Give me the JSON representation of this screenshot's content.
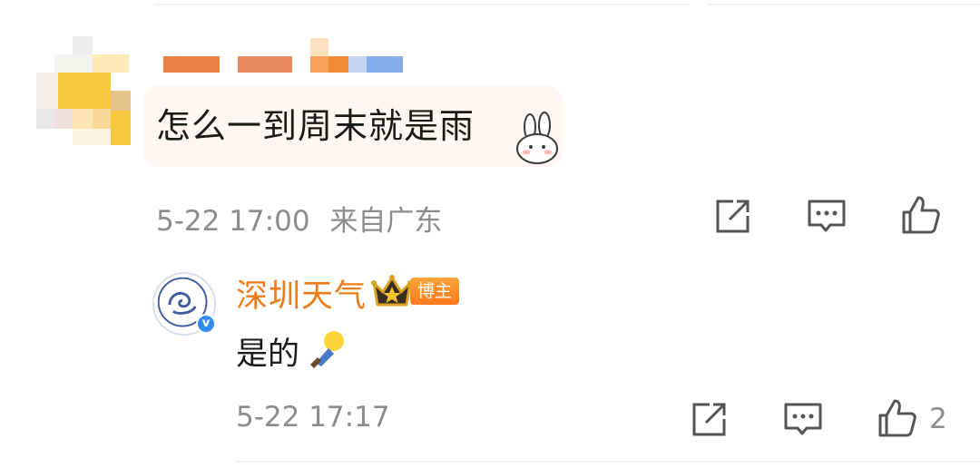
{
  "comment": {
    "text": "怎么一到周末就是雨",
    "time": "5-22 17:00",
    "location": "来自广东",
    "sticker": "bunny-sticker"
  },
  "reply": {
    "author": "深圳天气",
    "role_badge": "博主",
    "text": "是的",
    "time": "5-22 17:17",
    "like_count": "2",
    "verified_icon": "v",
    "emoji": "lightbulb-emoji"
  },
  "icons": [
    "share-icon",
    "comment-icon",
    "like-icon",
    "crown-icon"
  ],
  "colors": {
    "name_orange": "#ee7a1a",
    "meta_gray": "#8c8c8c",
    "bubble_bg": "#fdf6f3",
    "verify_blue": "#2f8df0"
  }
}
